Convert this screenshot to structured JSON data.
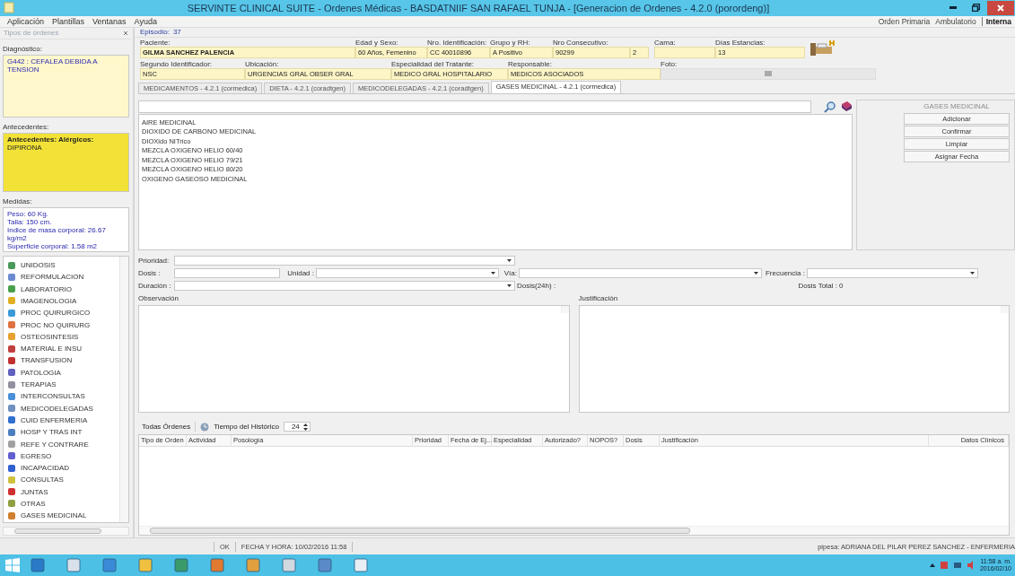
{
  "window": {
    "title": "SERVINTE CLINICAL SUITE - Ordenes Médicas - BASDATNIIF SAN RAFAEL TUNJA - [Generacion de Ordenes - 4.2.0 (porordeng)]"
  },
  "menu": [
    "Aplicación",
    "Plantillas",
    "Ventanas",
    "Ayuda"
  ],
  "modes": [
    {
      "label": "Orden Primaria",
      "selected": false
    },
    {
      "label": "Ambulatorio",
      "selected": false
    },
    {
      "label": "Interna",
      "selected": true
    }
  ],
  "sidebar": {
    "title": "Tipos de órdenes",
    "diagnosis_label": "Diagnóstico:",
    "diagnosis": "G442 : CEFALEA DEBIDA A TENSION",
    "history_label": "Antecedentes:",
    "history_heading": "Antecedentes: Alérgicos:",
    "history": "DIPIRONA",
    "measures_label": "Medidas:",
    "measures": [
      "Peso: 60 Kg.",
      "Talla: 150 cm.",
      "Indice de masa corporal: 26.67 kg/m2",
      "Superficie corporal: 1.58 m2"
    ],
    "order_types": [
      "UNIDOSIS",
      "REFORMULACION",
      "LABORATORIO",
      "IMAGENOLOGIA",
      "PROC QUIRURGICO",
      "PROC NO QUIRURG",
      "OSTEOSINTESIS",
      "MATERIAL E INSU",
      "TRANSFUSION",
      "PATOLOGIA",
      "TERAPIAS",
      "INTERCONSULTAS",
      "MEDICODELEGADAS",
      "CUID ENFERMERIA",
      "HOSP Y TRAS INT",
      "REFE Y CONTRARE",
      "EGRESO",
      "INCAPACIDAD",
      "CONSULTAS",
      "JUNTAS",
      "OTRAS",
      "GASES MEDICINAL"
    ]
  },
  "episode": {
    "label": "Episodio:",
    "value": "37"
  },
  "patient": {
    "row_1": [
      {
        "label": "Paciente:",
        "value": "GILMA SANCHEZ PALENCIA"
      },
      {
        "label": "Edad y Sexo:",
        "value": "60 Años, Femenino"
      },
      {
        "label": "Nro. Identificación:",
        "value": "CC 40010896"
      },
      {
        "label": "Grupo y RH:",
        "value": "A Positivo"
      },
      {
        "label": "Nro Consecutivo:",
        "value": "90299",
        "value_2": "2"
      },
      {
        "label": "Cama:"
      },
      {
        "label": "Días Estancias:",
        "value": "13"
      }
    ],
    "row_2": [
      {
        "label": "Segundo Identificador:",
        "value": "NSC"
      },
      {
        "label": "Ubicación:",
        "value": "URGENCIAS GRAL OBSER GRAL"
      },
      {
        "label": "Especialidad del Tratante:",
        "value": "MEDICO GRAL HOSPITALARIO"
      },
      {
        "label": "Responsable:",
        "value": "MEDICOS ASOCIADOS"
      }
    ],
    "photo_label": "Foto:"
  },
  "tabs": [
    {
      "label": "MEDICAMENTOS - 4.2.1 (cormedica)",
      "selected": false
    },
    {
      "label": "DIETA - 4.2.1 (coradtgen)",
      "selected": false
    },
    {
      "label": "MEDICODELEGADAS - 4.2.1 (coradtgen)",
      "selected": false
    },
    {
      "label": "GASES MEDICINAL - 4.2.1 (cormedica)",
      "selected": true
    }
  ],
  "gases": [
    "AIRE MEDICINAL",
    "DIOXIDO DE CARBONO MEDICINAL",
    "DIOXido NITrico",
    "MEZCLA OXIGENO  HELIO 60/40",
    "MEZCLA OXIGENO  HELIO 79/21",
    "MEZCLA OXIGENO  HELIO 80/20",
    "OXIGENO GASEOSO MEDICINAL"
  ],
  "actions": {
    "title": "GASES MEDICINAL",
    "buttons": [
      "Adicionar",
      "Confirmar",
      "Limpiar",
      "Asignar Fecha"
    ]
  },
  "form": {
    "priority": "Prioridad:",
    "dose": "Dosis :",
    "unit": "Unidad :",
    "route": "Vía:",
    "frequency": "Frecuencia :",
    "duration": "Duración :",
    "dose_24h": "Dosis(24h) :",
    "total_dose_label": "Dosis Total :",
    "total_dose": "0",
    "observation": "Observación",
    "justification": "Justificación"
  },
  "history": {
    "all_orders": "Todas Órdenes",
    "time_label": "Tiempo del Histórico",
    "time_value": "24",
    "columns": [
      "Tipo de Orden",
      "Actividad",
      "Posología",
      "Prioridad",
      "Fecha de Ej...",
      "Especialidad",
      "Autorizado?",
      "NOPOS?",
      "Dosis",
      "Justificación",
      "Datos Clínicos"
    ]
  },
  "status_bar": {
    "state": "OK",
    "datetime": "FECHA Y HORA: 10/02/2016 11:58",
    "user": "pipesa: ADRIANA DEL PILAR PEREZ SANCHEZ - ENFERMERIA"
  },
  "taskbar": {
    "time": "11:58 a. m.",
    "date": "2016/02/10"
  }
}
